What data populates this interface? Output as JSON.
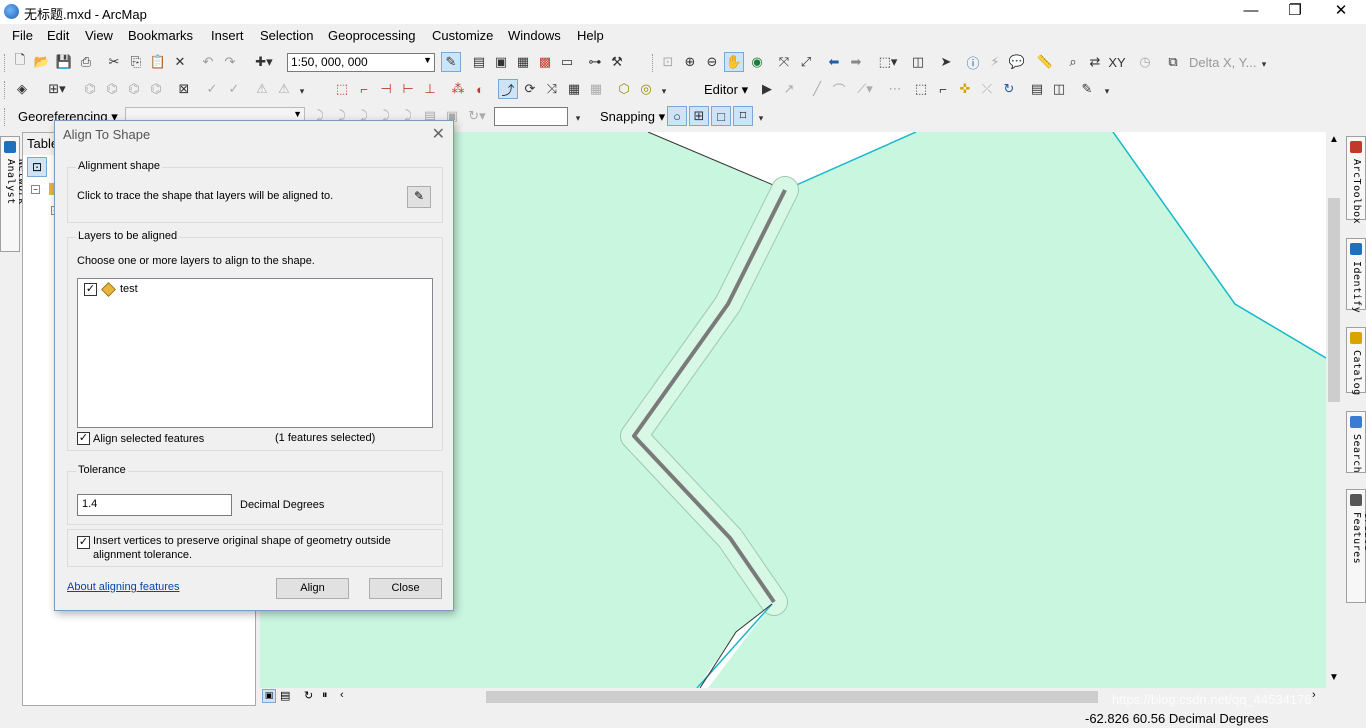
{
  "window": {
    "title": "无标题.mxd - ArcMap",
    "minimize": "—",
    "maximize": "❐",
    "close": "✕"
  },
  "menu": [
    "File",
    "Edit",
    "View",
    "Bookmarks",
    "Insert",
    "Selection",
    "Geoprocessing",
    "Customize",
    "Windows",
    "Help"
  ],
  "toolbar": {
    "scale": "1:50, 000, 000",
    "delta_placeholder": "Delta X, Y...",
    "editor_label": "Editor",
    "georeferencing_label": "Georeferencing",
    "snapping_label": "Snapping"
  },
  "toc": {
    "title": "Table"
  },
  "left_strip": {
    "label": "Network Analyst"
  },
  "right_dock": {
    "tabs": [
      {
        "label": "ArcToolbox",
        "icon": "toolbox-icon",
        "color": "#c0392b"
      },
      {
        "label": "Identify",
        "icon": "identify-icon",
        "color": "#1f6fbf"
      },
      {
        "label": "Catalog",
        "icon": "catalog-icon",
        "color": "#d9a400"
      },
      {
        "label": "Search",
        "icon": "search-icon",
        "color": "#3a7bd5"
      },
      {
        "label": "Create Features",
        "icon": "create-features-icon",
        "color": "#555555"
      }
    ]
  },
  "status": {
    "coords": "-62.826  60.56 Decimal Degrees"
  },
  "watermark": "https://blog.csdn.net/qq_44534176",
  "dialog": {
    "title": "Align To Shape",
    "alignment_shape_label": "Alignment shape",
    "trace_instruction": "Click to trace the shape that layers will be aligned to.",
    "layers_label": "Layers to be aligned",
    "layers_instruction": "Choose one or more layers to align to the shape.",
    "layers": [
      {
        "name": "test",
        "checked": true
      }
    ],
    "align_selected_label": "Align selected features",
    "selected_count": "(1 features selected)",
    "tolerance_label": "Tolerance",
    "tolerance_value": "1.4",
    "tolerance_unit": "Decimal Degrees",
    "insert_vertices_label_1": "Insert vertices to preserve original shape of geometry outside",
    "insert_vertices_label_2": "alignment tolerance.",
    "about_link": "About aligning features",
    "align_button": "Align",
    "close_button": "Close"
  },
  "colors": {
    "map_fill": "#c9f6df",
    "boundary": "#17b7c9",
    "trace": "#7a7a7a"
  }
}
